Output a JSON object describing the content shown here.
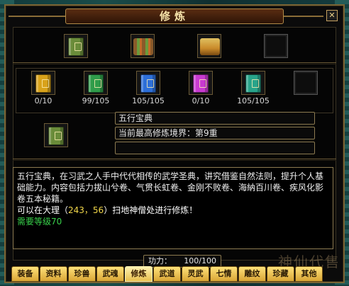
{
  "window": {
    "title": "修炼",
    "help_label": "?",
    "close_label": "✕"
  },
  "top_slots": [
    {
      "kind": "book",
      "color": "#6a8c3a",
      "accent": "#b89b4a"
    },
    {
      "kind": "scroll",
      "color": "#8a5a2a",
      "accent": "#6b9a3c"
    },
    {
      "kind": "scroll",
      "color": "#c98a2a",
      "accent": "#e0c060"
    },
    {
      "kind": "empty"
    }
  ],
  "books": [
    {
      "color": "#d8a21a",
      "count": "0/10"
    },
    {
      "color": "#2f9c4a",
      "count": "99/105"
    },
    {
      "color": "#2d6fd8",
      "count": "105/105"
    },
    {
      "color": "#c83ad0",
      "count": "0/10"
    },
    {
      "color": "#28a48a",
      "count": "105/105"
    },
    {
      "color": null,
      "count": ""
    }
  ],
  "selected": {
    "name": "五行宝典",
    "realm": "当前最高修炼境界：第9重",
    "extra": ""
  },
  "description": {
    "text": "五行宝典，在习武之人手中代代相传的武学圣典，讲究借鉴自然法则，提升个人基础能力。内容包括力拔山兮卷、气贯长虹卷、金刚不败卷、海納百川卷、疾风化影卷五本秘籍。",
    "location_prefix": "可以在大理（",
    "location_coords": "243，56",
    "location_suffix": "）扫地神僧处进行修炼！",
    "requirement": "需要等级70"
  },
  "power": {
    "label": "功力：",
    "value": "100/100"
  },
  "tabs": [
    {
      "label": "装备",
      "active": false
    },
    {
      "label": "资料",
      "active": false
    },
    {
      "label": "珍兽",
      "active": false
    },
    {
      "label": "武魂",
      "active": false
    },
    {
      "label": "修炼",
      "active": true
    },
    {
      "label": "武道",
      "active": false
    },
    {
      "label": "灵武",
      "active": false
    },
    {
      "label": "七情",
      "active": false
    },
    {
      "label": "雕纹",
      "active": false
    },
    {
      "label": "珍藏",
      "active": false
    },
    {
      "label": "其他",
      "active": false
    }
  ],
  "watermark": "神仙代售"
}
